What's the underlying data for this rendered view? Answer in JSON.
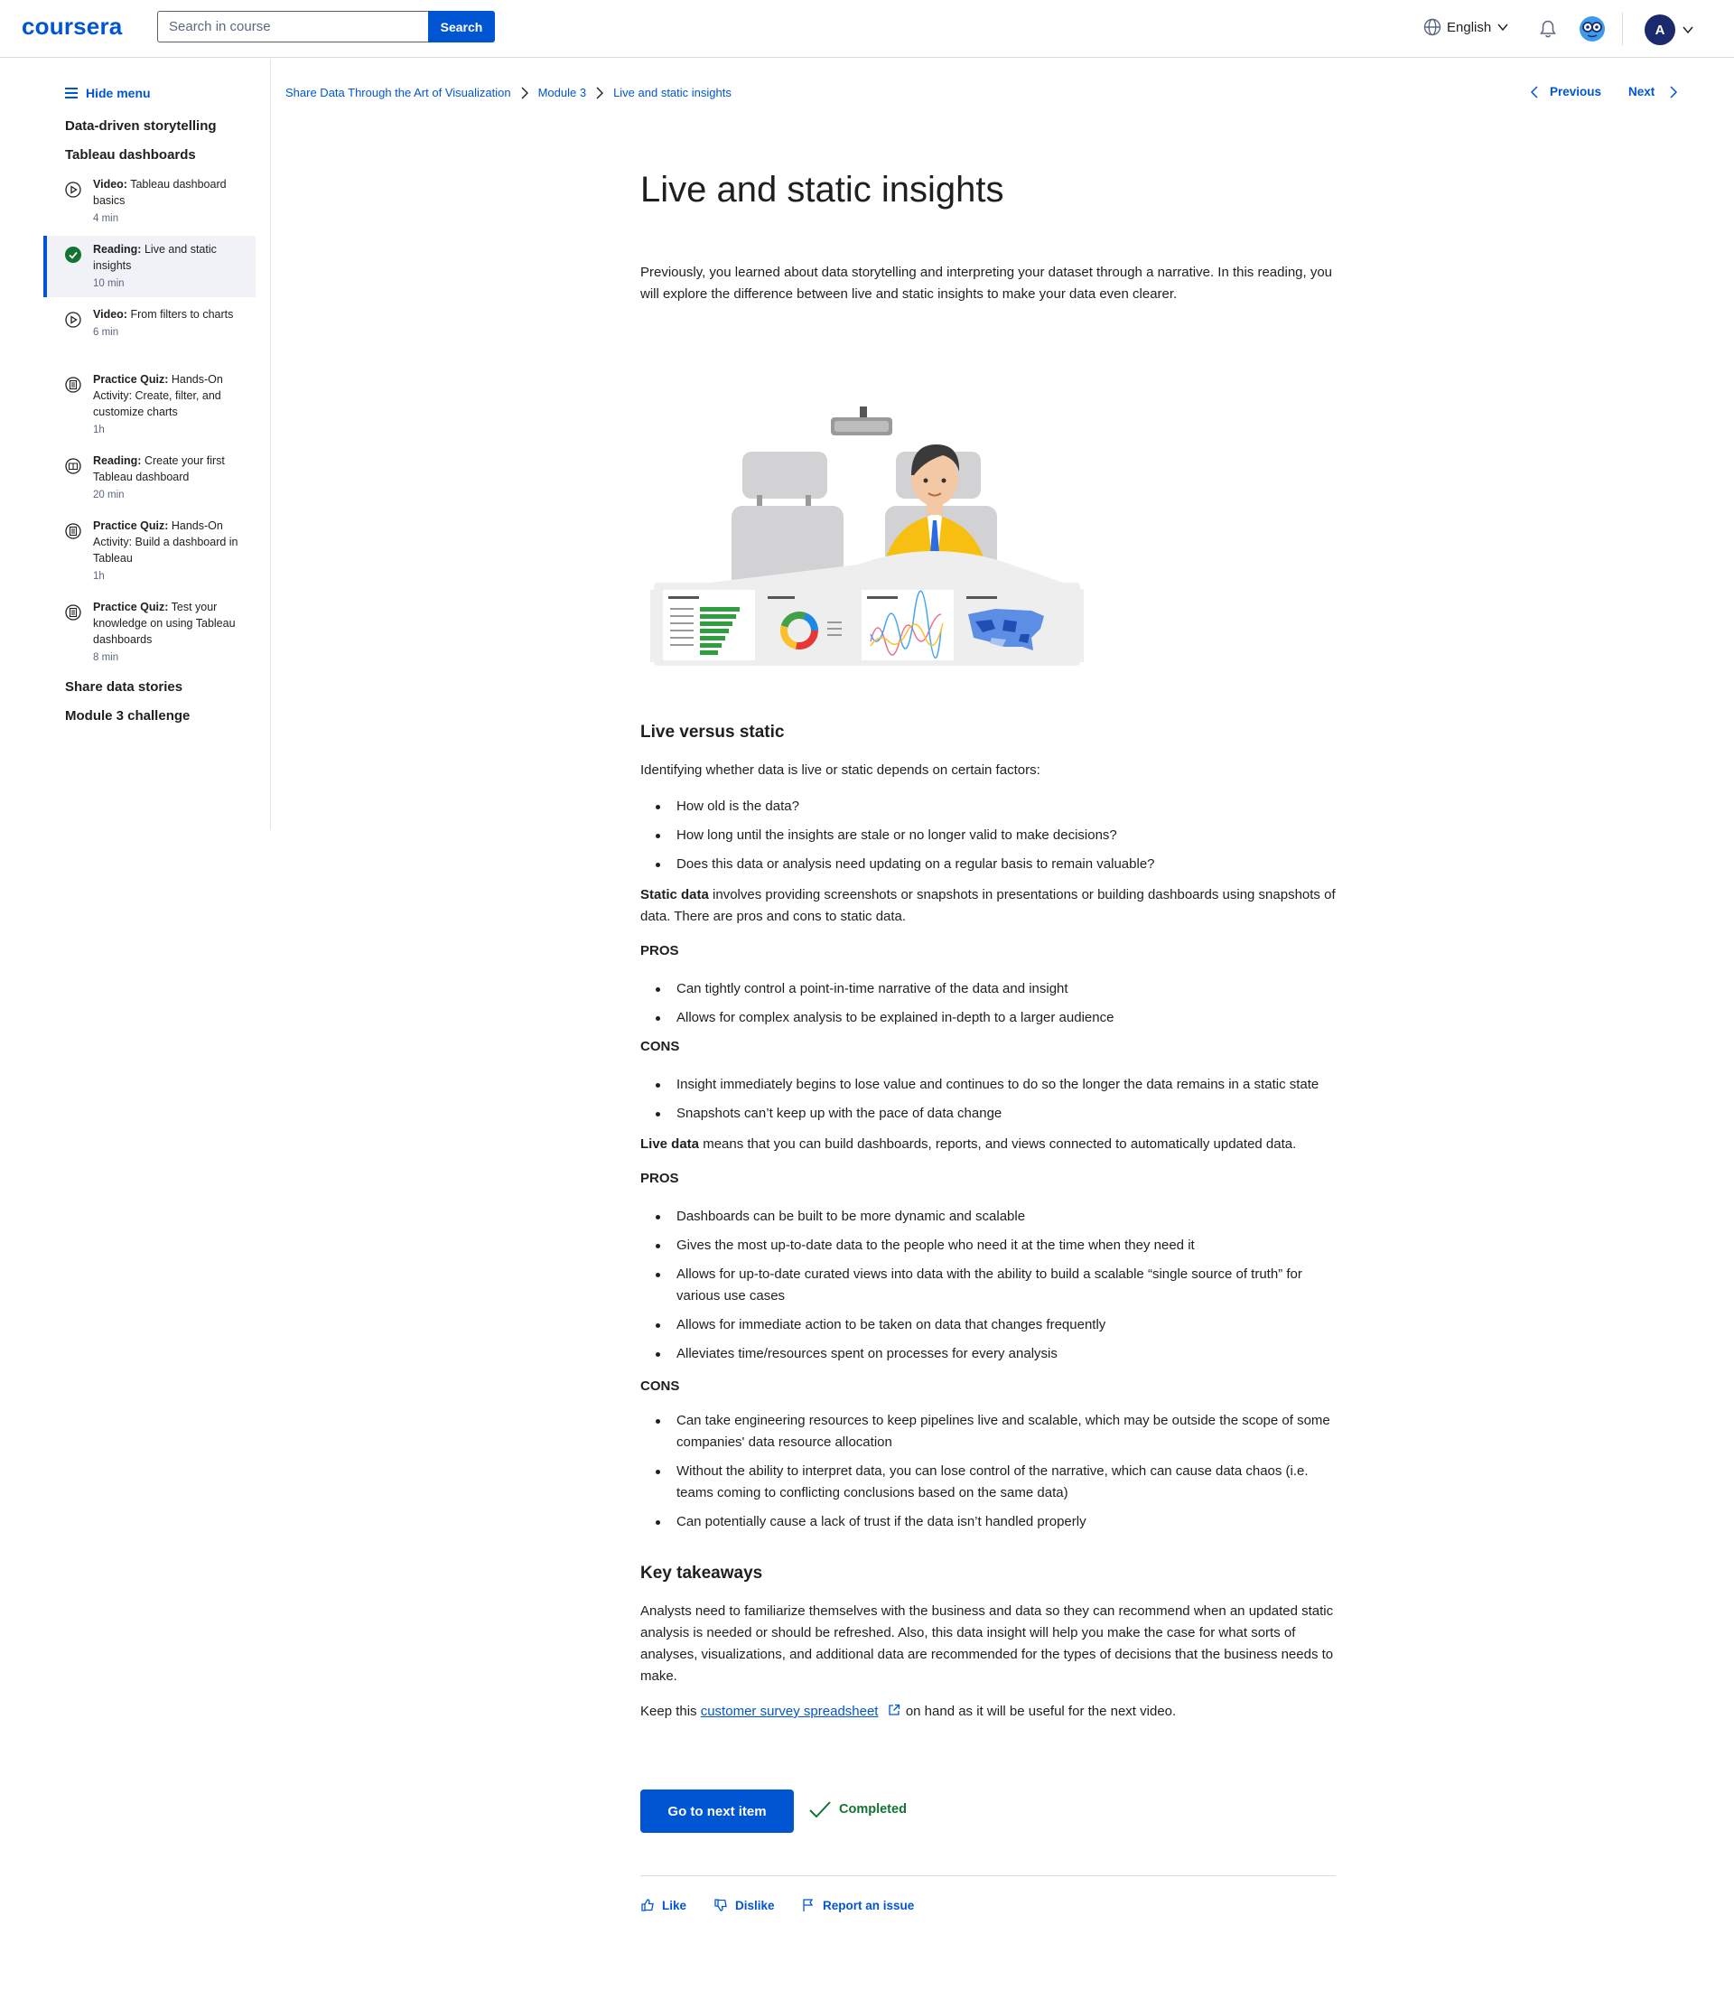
{
  "header": {
    "logo": "coursera",
    "search_placeholder": "Search in course",
    "search_button": "Search",
    "language": "English",
    "avatar_initial": "A"
  },
  "sidebar": {
    "hide_menu": "Hide menu",
    "sections": [
      "Data-driven storytelling",
      "Tableau dashboards",
      "Share data stories",
      "Module 3 challenge"
    ],
    "items": [
      {
        "type": "Video:",
        "title": "Tableau dashboard basics",
        "duration": "4 min",
        "icon": "play-icon"
      },
      {
        "type": "Reading:",
        "title": "Live and static insights",
        "duration": "10 min",
        "icon": "check-circle-icon"
      },
      {
        "type": "Video:",
        "title": "From filters to charts",
        "duration": "6 min",
        "icon": "play-icon"
      },
      {
        "type": "Practice Quiz:",
        "title": "Hands-On Activity: Create, filter, and customize charts",
        "duration": "1h",
        "icon": "quiz-icon"
      },
      {
        "type": "Reading:",
        "title": "Create your first Tableau dashboard",
        "duration": "20 min",
        "icon": "book-icon"
      },
      {
        "type": "Practice Quiz:",
        "title": "Hands-On Activity: Build a dashboard in Tableau",
        "duration": "1h",
        "icon": "quiz-icon"
      },
      {
        "type": "Practice Quiz:",
        "title": "Test your knowledge on using Tableau dashboards",
        "duration": "8 min",
        "icon": "quiz-icon"
      }
    ]
  },
  "breadcrumb": [
    "Share Data Through the Art of Visualization",
    "Module 3",
    "Live and static insights"
  ],
  "nav": {
    "previous": "Previous",
    "next": "Next"
  },
  "content": {
    "title": "Live and static insights",
    "intro": "Previously, you learned about data storytelling and interpreting your dataset through a narrative. In this reading, you will explore the difference between live and static insights to make your data even clearer.",
    "section1_title": "Live versus static",
    "factors_intro": "Identifying whether data is live or static depends on certain factors:",
    "factors": [
      "How old is the data?",
      "How long until the insights are stale or no longer valid to make decisions?",
      "Does this data or analysis need updating on a regular basis to remain valuable?"
    ],
    "static_term": "Static data",
    "static_def": " involves providing screenshots or snapshots in presentations or building dashboards using snapshots of data. There are pros and cons to static data.",
    "pros_label": "PROS",
    "cons_label": "CONS",
    "static_pros": [
      "Can tightly control a point-in-time narrative of the data and insight",
      "Allows for complex analysis to be explained in-depth to a larger audience"
    ],
    "static_cons": [
      "Insight immediately begins to lose value and continues to do so the longer the data remains in a static state",
      "Snapshots can’t keep up with the pace of data change"
    ],
    "live_term": "Live data",
    "live_def": " means that you can build dashboards, reports, and views connected to automatically updated data.",
    "live_pros": [
      "Dashboards can be built to be more dynamic and scalable",
      "Gives the most up-to-date data to the people who need it at the time when they need it",
      "Allows for up-to-date curated views into data with the ability to build a scalable “single source of truth” for various use cases",
      "Allows for immediate action to be taken on data that changes frequently",
      "Alleviates time/resources spent on processes for every analysis"
    ],
    "live_cons": [
      "Can take engineering resources to keep pipelines live and scalable, which may be outside the scope of some companies' data resource allocation",
      "Without the ability to interpret data, you can lose control of the narrative, which can cause data chaos (i.e. teams coming to conflicting conclusions based on the same data)",
      "Can potentially cause a lack of trust if the data isn’t handled properly"
    ],
    "takeaways_title": "Key takeaways",
    "takeaways": "Analysts need to familiarize themselves with the business and data so they can recommend when an updated static analysis is needed or should be refreshed. Also, this data insight will help you make the case for what sorts of analyses, visualizations, and additional data are recommended for the types of decisions that the business needs to make.",
    "keep_prefix": "Keep this ",
    "keep_link": "customer survey spreadsheet",
    "keep_suffix": " on hand as it will be useful for the next video."
  },
  "actions": {
    "next_item": "Go to next item",
    "completed": "Completed",
    "like": "Like",
    "dislike": "Dislike",
    "report": "Report an issue"
  },
  "colors": {
    "brand": "#0056d2",
    "success": "#137333",
    "text": "#1f1f1f",
    "active_bg": "#f0f2f7"
  }
}
